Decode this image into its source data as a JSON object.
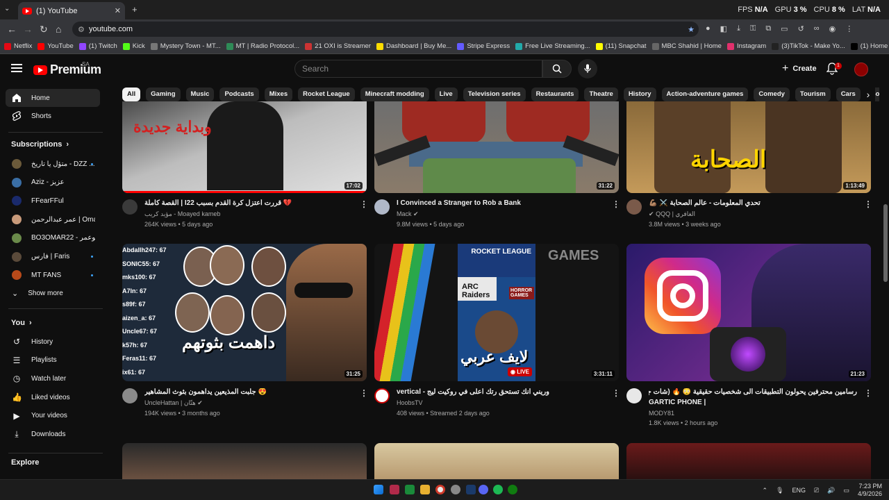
{
  "browser": {
    "tab_title": "(1) YouTube",
    "new_tab": "+",
    "url": "youtube.com",
    "overlay": {
      "fps_label": "FPS",
      "fps_value": "N/A",
      "gpu_label": "GPU",
      "gpu_value": "3 %",
      "cpu_label": "CPU",
      "cpu_value": "8 %",
      "lat_label": "LAT",
      "lat_value": "N/A"
    },
    "bookmarks": [
      {
        "label": "Netflix",
        "color": "#e50914"
      },
      {
        "label": "YouTube",
        "color": "#ff0000"
      },
      {
        "label": "(1) Twitch",
        "color": "#9146ff"
      },
      {
        "label": "Kick",
        "color": "#53fc18"
      },
      {
        "label": "Mystery Town - MT...",
        "color": "#777777"
      },
      {
        "label": "MT | Radio Protocol...",
        "color": "#2e8b57"
      },
      {
        "label": "21 OXI is Streamer",
        "color": "#cc3333"
      },
      {
        "label": "Dashboard | Buy Me...",
        "color": "#ffdd00"
      },
      {
        "label": "Stripe Express",
        "color": "#635bff"
      },
      {
        "label": "Free Live Streaming...",
        "color": "#22aaaa"
      },
      {
        "label": "(11) Snapchat",
        "color": "#fffc00"
      },
      {
        "label": "MBC Shahid | Home",
        "color": "#666666"
      },
      {
        "label": "Instagram",
        "color": "#e1306c"
      },
      {
        "label": "(3)TikTok - Make Yo...",
        "color": "#222222"
      },
      {
        "label": "(1) Home / X",
        "color": "#000000"
      }
    ]
  },
  "masthead": {
    "logo": "Premium",
    "region": "SA",
    "search_placeholder": "Search",
    "create_label": "Create",
    "notification_count": "1"
  },
  "chips": [
    "All",
    "Gaming",
    "Music",
    "Podcasts",
    "Mixes",
    "Rocket League",
    "Minecraft modding",
    "Live",
    "Television series",
    "Restaurants",
    "Theatre",
    "History",
    "Action-adventure games",
    "Comedy",
    "Tourism",
    "Cars",
    "Bo"
  ],
  "sidebar": {
    "main": [
      {
        "label": "Home",
        "icon": "home-icon"
      },
      {
        "label": "Shorts",
        "icon": "shorts-icon"
      }
    ],
    "subscriptions_title": "Subscriptions",
    "subscriptions": [
      {
        "label": "متؤل يا تاريخ - DZZ ...",
        "color": "#6b5a3a",
        "dot": true
      },
      {
        "label": "Aziz - عزيز",
        "color": "#3a6ea5",
        "dot": false
      },
      {
        "label": "FFearFFul",
        "color": "#1a2a6c",
        "dot": false
      },
      {
        "label": "عمر عبدالرحمن | Omar ...",
        "color": "#c89a7a",
        "dot": false
      },
      {
        "label": "BO3OMAR22 - ابوعمر",
        "color": "#6a8a4a",
        "dot": false
      },
      {
        "label": "فارس | Faris",
        "color": "#5a4a3a",
        "dot": true
      },
      {
        "label": "MT FANS",
        "color": "#b84a1a",
        "dot": true
      }
    ],
    "show_more": "Show more",
    "you_title": "You",
    "you_items": [
      {
        "label": "History",
        "icon": "history-icon"
      },
      {
        "label": "Playlists",
        "icon": "playlists-icon"
      },
      {
        "label": "Watch later",
        "icon": "watch-later-icon"
      },
      {
        "label": "Liked videos",
        "icon": "liked-videos-icon"
      },
      {
        "label": "Your videos",
        "icon": "your-videos-icon"
      },
      {
        "label": "Downloads",
        "icon": "downloads-icon"
      }
    ],
    "explore_title": "Explore"
  },
  "videos": [
    {
      "title": "💔 قررت أعتزل كرة القدم بسبب I22 | القصة كاملة",
      "channel": "مؤيد كريب - Moayed kameb",
      "meta": "264K views • 5 days ago",
      "duration": "17:02",
      "thumb_text": "وبداية جديدة",
      "verified": false
    },
    {
      "title": "I Convinced a Stranger to Rob a Bank",
      "channel": "Mack",
      "meta": "9.8M views • 5 days ago",
      "duration": "31:22",
      "thumb_text": "",
      "verified": true
    },
    {
      "title": "تحدي المعلومات - عالم الصحابة ⚔️ 💪🏽",
      "channel": "QQQ | الغافري",
      "meta": "3.8M views • 3 weeks ago",
      "duration": "1:13:49",
      "thumb_text": "الصحابة",
      "verified": true
    },
    {
      "title": "😍 جلبت المذيعين يداهمون بثوث المشاهير",
      "channel": "UncleHattan | هتّان",
      "meta": "194K views • 3 months ago",
      "duration": "31:25",
      "thumb_text": "داهمت بثوتهم",
      "verified": true
    },
    {
      "title": "وريني انك تستحق رتك اعلى في روكيت ليج - vertical",
      "channel": "HoobsTV",
      "meta": "408 views • Streamed 2 days ago",
      "duration": "3:31:11",
      "thumb_text": "لايف عربي",
      "verified": false,
      "live_badge": "LIVE"
    },
    {
      "title": "رسامين محترفين يحولون التطبيقات الى شخصيات حقيقية 😳 🔥 (شات جيبيتي فخم ؟؟)",
      "title_line2": "GARTIC PHONE |",
      "channel": "MODY81",
      "meta": "1.8K views • 2 hours ago",
      "duration": "21:23",
      "thumb_text": "",
      "verified": false
    }
  ],
  "thumb_overlays": {
    "scoreboard": [
      "Abdallh247: 67",
      "SONIC55: 67",
      "mks100: 67",
      "A7ln: 67",
      "s89f: 67",
      "aizen_a: 67",
      "Uncle67: 67",
      "k57h: 67",
      "Feras11: 67",
      "ix61: 67"
    ],
    "rocket_league": "ROCKET LEAGUE",
    "arc_raiders": "ARC Raiders",
    "horror_games": "HORROR GAMES",
    "games": "GAMES"
  },
  "taskbar": {
    "lang": "ENG",
    "time": "7:23 PM",
    "date": "4/9/2026"
  }
}
